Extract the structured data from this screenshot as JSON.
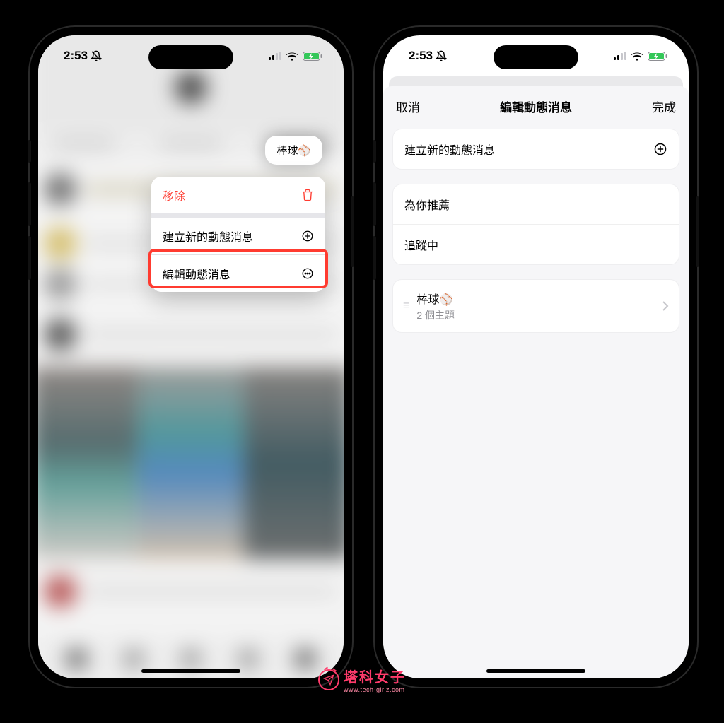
{
  "status": {
    "time": "2:53"
  },
  "left": {
    "pill_label": "棒球⚾",
    "menu": {
      "remove": "移除",
      "create": "建立新的動態消息",
      "edit": "編輯動態消息"
    }
  },
  "right": {
    "header": {
      "cancel": "取消",
      "title": "編輯動態消息",
      "done": "完成"
    },
    "create_row": "建立新的動態消息",
    "defaults": {
      "for_you": "為你推薦",
      "following": "追蹤中"
    },
    "feed": {
      "name": "棒球⚾",
      "subtitle": "2 個主題"
    }
  },
  "watermark": {
    "title": "塔科女子",
    "url": "www.tech-girlz.com"
  }
}
